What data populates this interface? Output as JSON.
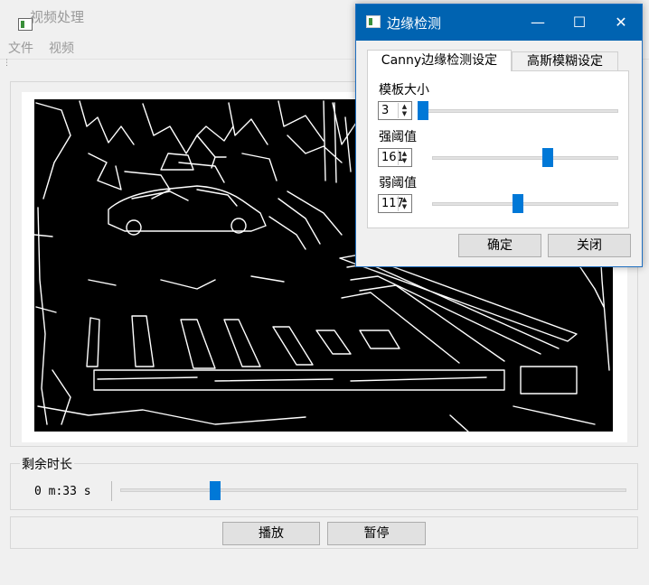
{
  "main": {
    "title": "视频处理",
    "menu": [
      "文件",
      "视频"
    ],
    "time_group_title": "剩余时长",
    "time_readout": "0 m:33 s",
    "time_slider_value": 0.18,
    "buttons": {
      "play": "播放",
      "pause": "暂停"
    }
  },
  "dialog": {
    "title": "边缘检测",
    "tabs": [
      "Canny边缘检测设定",
      "高斯模糊设定"
    ],
    "active_tab": "Canny边缘检测设定",
    "fields": [
      {
        "label": "模板大小",
        "value": "3",
        "slider_fraction": 0.0
      },
      {
        "label": "强阈值",
        "value": "161",
        "slider_fraction": 0.63
      },
      {
        "label": "弱阈值",
        "value": "117",
        "slider_fraction": 0.46
      }
    ],
    "ok_label": "确定",
    "close_label": "关闭",
    "title_controls": {
      "minimize": "—",
      "maximize": "☐",
      "close": "✕"
    }
  },
  "colors": {
    "accent": "#0078d7",
    "dialog_titlebar": "#0063b1",
    "video_background": "#000000",
    "edge_lines": "#ffffff"
  }
}
